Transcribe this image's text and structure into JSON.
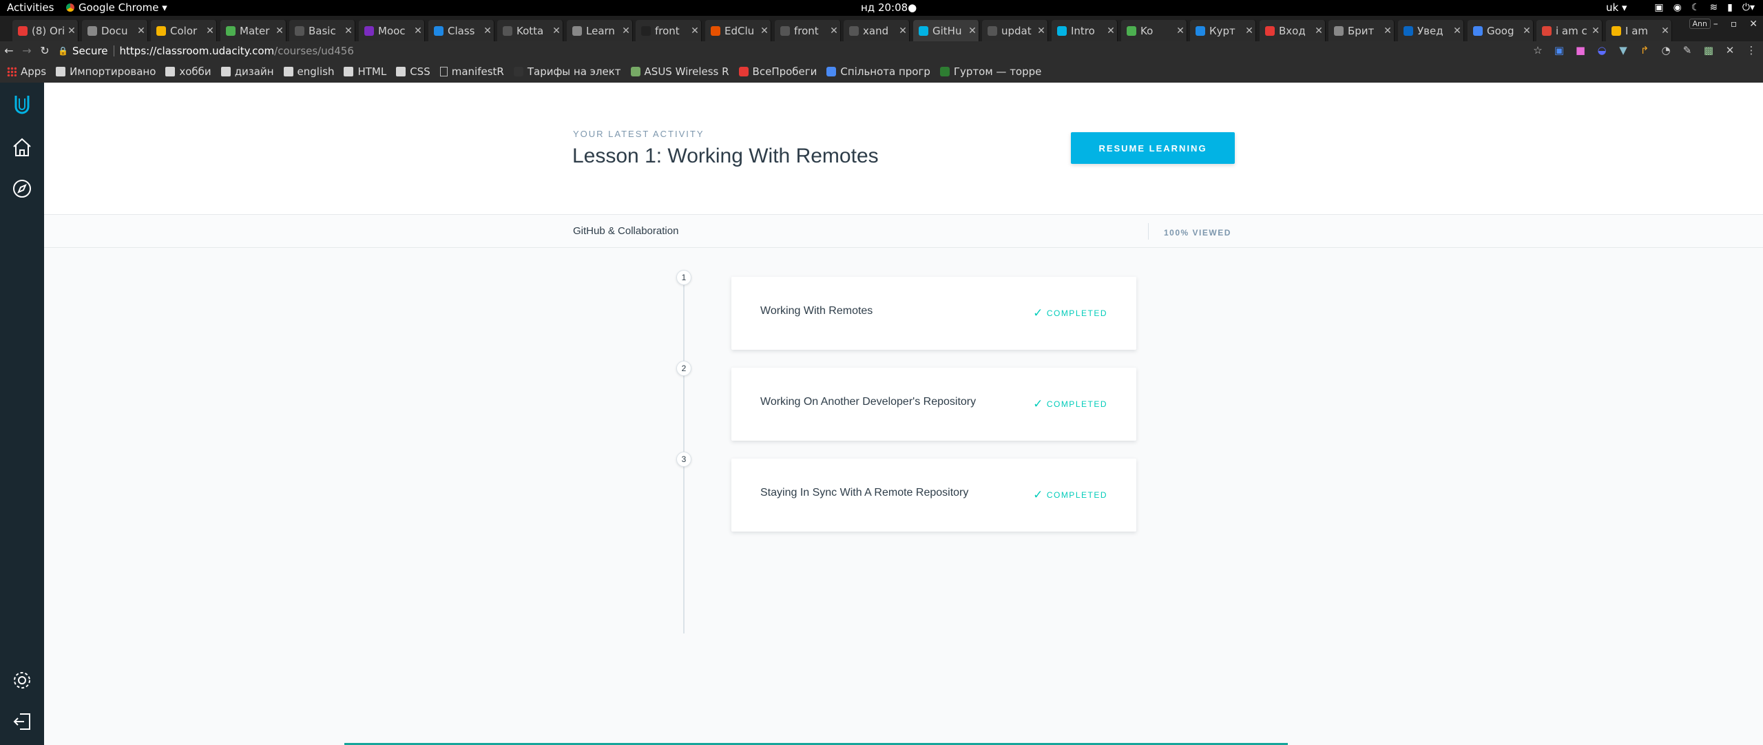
{
  "os": {
    "activities": "Activities",
    "app_name": "Google Chrome ▾",
    "clock": "нд 20:08●",
    "language": "uk ▾"
  },
  "browser": {
    "tabs": [
      {
        "title": "(8) Ori",
        "color": "#e53935"
      },
      {
        "title": "Docu",
        "color": "#888888"
      },
      {
        "title": "Color",
        "color": "#f5b400"
      },
      {
        "title": "Mater",
        "color": "#4caf50"
      },
      {
        "title": "Basic",
        "color": "#555555"
      },
      {
        "title": "Mooc",
        "color": "#7b2cbf"
      },
      {
        "title": "Class",
        "color": "#1e88e5"
      },
      {
        "title": "Kotta",
        "color": "#555555"
      },
      {
        "title": "Learn",
        "color": "#888888"
      },
      {
        "title": "front",
        "color": "#222222"
      },
      {
        "title": "EdClu",
        "color": "#e65100"
      },
      {
        "title": "front",
        "color": "#555555"
      },
      {
        "title": "xand",
        "color": "#555555"
      },
      {
        "title": "GitHu",
        "color": "#02b3e4"
      },
      {
        "title": "updat",
        "color": "#555555"
      },
      {
        "title": "Intro",
        "color": "#02b3e4"
      },
      {
        "title": "Ko",
        "color": "#4caf50"
      },
      {
        "title": "Курт",
        "color": "#1e88e5"
      },
      {
        "title": "Вход",
        "color": "#e53935"
      },
      {
        "title": "Брит",
        "color": "#888888"
      },
      {
        "title": "Увед",
        "color": "#0a66c2"
      },
      {
        "title": "Goog",
        "color": "#4285f4"
      },
      {
        "title": "i am c",
        "color": "#db4437"
      },
      {
        "title": "I am",
        "color": "#f5b400"
      }
    ],
    "profile": "Ann",
    "secure_label": "Secure",
    "url_host": "https://classroom.udacity.com",
    "url_path": "/courses/ud456",
    "bookmarks": [
      {
        "label": "Apps",
        "kind": "apps"
      },
      {
        "label": "Импортировано",
        "kind": "folder"
      },
      {
        "label": "хобби",
        "kind": "folder"
      },
      {
        "label": "дизайн",
        "kind": "folder"
      },
      {
        "label": "english",
        "kind": "folder"
      },
      {
        "label": "HTML",
        "kind": "folder"
      },
      {
        "label": "CSS",
        "kind": "folder"
      },
      {
        "label": "manifestR",
        "kind": "page"
      },
      {
        "label": "Тарифы на элект",
        "kind": "site"
      },
      {
        "label": "ASUS Wireless R",
        "kind": "site"
      },
      {
        "label": "ВсеПробеги",
        "kind": "site"
      },
      {
        "label": "Спільнота прогр",
        "kind": "site"
      },
      {
        "label": "Гуртом — торре",
        "kind": "site"
      }
    ]
  },
  "course": {
    "eyebrow": "YOUR LATEST ACTIVITY",
    "lesson_title": "Lesson 1: Working With Remotes",
    "resume_label": "RESUME LEARNING",
    "course_name": "GitHub & Collaboration",
    "viewed": "100% VIEWED",
    "lessons": [
      {
        "number": "1",
        "title": "Working With Remotes",
        "status": "COMPLETED"
      },
      {
        "number": "2",
        "title": "Working On Another Developer's Repository",
        "status": "COMPLETED"
      },
      {
        "number": "3",
        "title": "Staying In Sync With A Remote Repository",
        "status": "COMPLETED"
      }
    ]
  }
}
